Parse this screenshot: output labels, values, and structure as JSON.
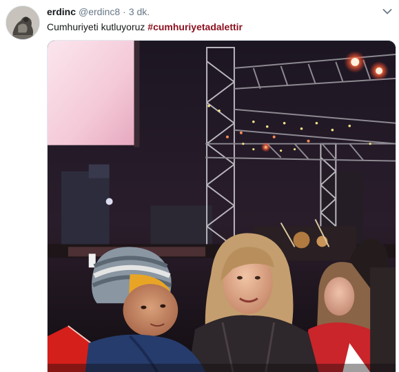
{
  "tweet": {
    "display_name": "erdinc",
    "handle": "@erdinc8",
    "separator": "·",
    "time": "3 dk.",
    "text": "Cumhuriyeti kutluyoruz",
    "hashtag": "#cumhuriyetadalettir"
  },
  "icons": {
    "menu": "chevron-down-icon",
    "avatar": "profile-photo"
  },
  "colors": {
    "name": "#14171a",
    "meta": "#657786",
    "hashtag": "#8b0f1e",
    "border": "#e1e8ed"
  }
}
